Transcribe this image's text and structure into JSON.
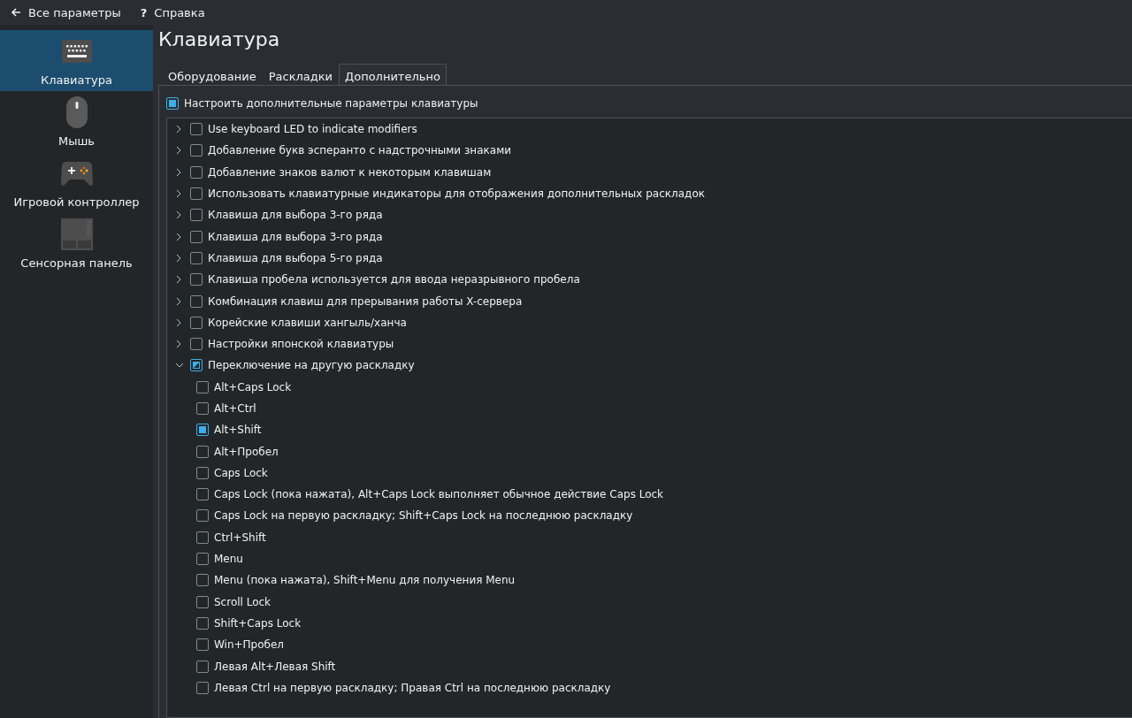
{
  "toolbar": {
    "back": "Все параметры",
    "help_icon": "?",
    "help": "Справка"
  },
  "sidebar": {
    "items": [
      {
        "label": "Клавиатура",
        "kind": "keyboard",
        "selected": true
      },
      {
        "label": "Мышь",
        "kind": "mouse",
        "selected": false
      },
      {
        "label": "Игровой контроллер",
        "kind": "gamepad",
        "selected": false
      },
      {
        "label": "Сенсорная панель",
        "kind": "touchpad",
        "selected": false
      }
    ]
  },
  "title": "Клавиатура",
  "tabs": [
    {
      "label": "Оборудование",
      "selected": false
    },
    {
      "label": "Раскладки",
      "selected": false
    },
    {
      "label": "Дополнительно",
      "selected": true
    }
  ],
  "configure": {
    "label": "Настроить дополнительные параметры клавиатуры",
    "checked": true
  },
  "tree": [
    {
      "label": "Use keyboard LED to indicate modifiers",
      "checked": false,
      "partial": false,
      "expanded": false
    },
    {
      "label": "Добавление букв эсперанто с надстрочными знаками",
      "checked": false,
      "partial": false,
      "expanded": false
    },
    {
      "label": "Добавление знаков валют к некоторым клавишам",
      "checked": false,
      "partial": false,
      "expanded": false
    },
    {
      "label": "Использовать клавиатурные индикаторы для отображения дополнительных раскладок",
      "checked": false,
      "partial": false,
      "expanded": false
    },
    {
      "label": "Клавиша для выбора 3-го ряда",
      "checked": false,
      "partial": false,
      "expanded": false
    },
    {
      "label": "Клавиша для выбора 3-го ряда",
      "checked": false,
      "partial": false,
      "expanded": false
    },
    {
      "label": "Клавиша для выбора 5-го ряда",
      "checked": false,
      "partial": false,
      "expanded": false
    },
    {
      "label": "Клавиша пробела используется для ввода неразрывного пробела",
      "checked": false,
      "partial": false,
      "expanded": false
    },
    {
      "label": "Комбинация клавиш для прерывания работы X-сервера",
      "checked": false,
      "partial": false,
      "expanded": false
    },
    {
      "label": "Корейские клавиши хангыль/ханча",
      "checked": false,
      "partial": false,
      "expanded": false
    },
    {
      "label": "Настройки японской клавиатуры",
      "checked": false,
      "partial": false,
      "expanded": false
    },
    {
      "label": "Переключение на другую раскладку",
      "checked": true,
      "partial": true,
      "expanded": true,
      "children": [
        {
          "label": "Alt+Caps Lock",
          "checked": false,
          "partial": false
        },
        {
          "label": "Alt+Ctrl",
          "checked": false,
          "partial": false
        },
        {
          "label": "Alt+Shift",
          "checked": true,
          "partial": false
        },
        {
          "label": "Alt+Пробел",
          "checked": false,
          "partial": false
        },
        {
          "label": "Caps Lock",
          "checked": false,
          "partial": false
        },
        {
          "label": "Caps Lock (пока нажата), Alt+Caps Lock выполняет обычное действие Caps Lock",
          "checked": false,
          "partial": false
        },
        {
          "label": "Caps Lock на первую раскладку; Shift+Caps Lock на последнюю раскладку",
          "checked": false,
          "partial": false
        },
        {
          "label": "Ctrl+Shift",
          "checked": false,
          "partial": false
        },
        {
          "label": "Menu",
          "checked": false,
          "partial": false
        },
        {
          "label": "Menu (пока нажата), Shift+Menu для получения Menu",
          "checked": false,
          "partial": false
        },
        {
          "label": "Scroll Lock",
          "checked": false,
          "partial": false
        },
        {
          "label": "Shift+Caps Lock",
          "checked": false,
          "partial": false
        },
        {
          "label": "Win+Пробел",
          "checked": false,
          "partial": false
        },
        {
          "label": "Левая Alt+Левая Shift",
          "checked": false,
          "partial": false
        },
        {
          "label": "Левая Ctrl на первую раскладку; Правая Ctrl на последнюю раскладку",
          "checked": false,
          "partial": false
        }
      ]
    }
  ]
}
